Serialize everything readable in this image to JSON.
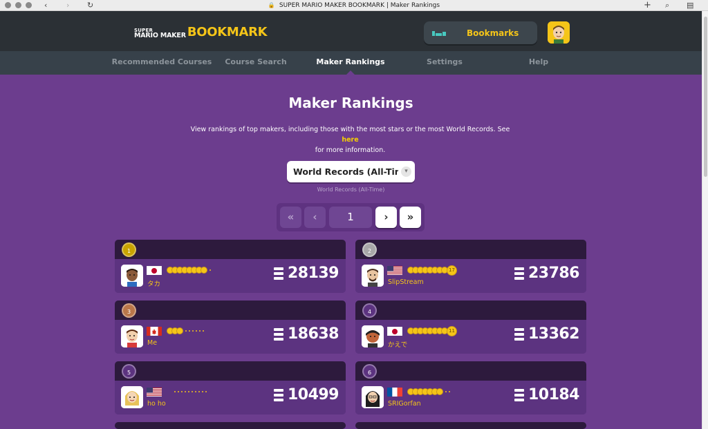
{
  "browser": {
    "title": "SUPER MARIO MAKER BOOKMARK | Maker Rankings",
    "back": "‹",
    "forward": "›",
    "reload": "↻",
    "new_tab": "+",
    "zoom": "⌕",
    "sidebar": "▤",
    "lock": "🔒"
  },
  "header": {
    "logo_line1": "SUPER",
    "logo_line2": "MARIO MAKER",
    "logo_bookmark": "BOOKMARK",
    "bookmarks_label": "Bookmarks"
  },
  "nav": {
    "items": [
      {
        "label": "Recommended Courses"
      },
      {
        "label": "Course Search"
      },
      {
        "label": "Maker Rankings"
      },
      {
        "label": "Settings"
      },
      {
        "label": "Help"
      }
    ],
    "active": "Maker Rankings"
  },
  "main": {
    "title": "Maker Rankings",
    "intro": "View rankings of top makers, including those with the most stars or the most World Records. See ",
    "intro_link": "here",
    "intro_tail": "for more information.",
    "select_value": "World Records (All-Tim…",
    "select_sub": "World Records (All-Time)"
  },
  "pager": {
    "first": "«",
    "prev": "‹",
    "page": "1",
    "next": "›",
    "last": "»"
  },
  "rankings": [
    {
      "rank": "1",
      "name": "タカ",
      "country": "Japan",
      "count": "28139",
      "medals_full": 8,
      "dots": 1,
      "medal_badge": ""
    },
    {
      "rank": "2",
      "name": "SlipStream",
      "country": "United States",
      "count": "23786",
      "medals_full": 8,
      "dots": 0,
      "medal_badge": "17"
    },
    {
      "rank": "3",
      "name": "Me",
      "country": "Canada",
      "count": "18638",
      "medals_full": 3,
      "dots": 6,
      "medal_badge": ""
    },
    {
      "rank": "4",
      "name": "かえで",
      "country": "Japan",
      "count": "13362",
      "medals_full": 8,
      "dots": 0,
      "medal_badge": "11"
    },
    {
      "rank": "5",
      "name": "ho ho",
      "country": "United States",
      "count": "10499",
      "medals_full": 0,
      "dots": 10,
      "medal_badge": ""
    },
    {
      "rank": "6",
      "name": "SRIGorfan",
      "country": "France",
      "count": "10184",
      "medals_full": 7,
      "dots": 2,
      "medal_badge": ""
    }
  ],
  "colors": {
    "page_bg": "#6c3d8e",
    "header_bg": "#2b3035",
    "nav_bg": "#37414a",
    "accent_yellow": "#f5c518",
    "gold": "#c9a400",
    "silver": "#a8a8a8",
    "bronze": "#b9774a"
  }
}
